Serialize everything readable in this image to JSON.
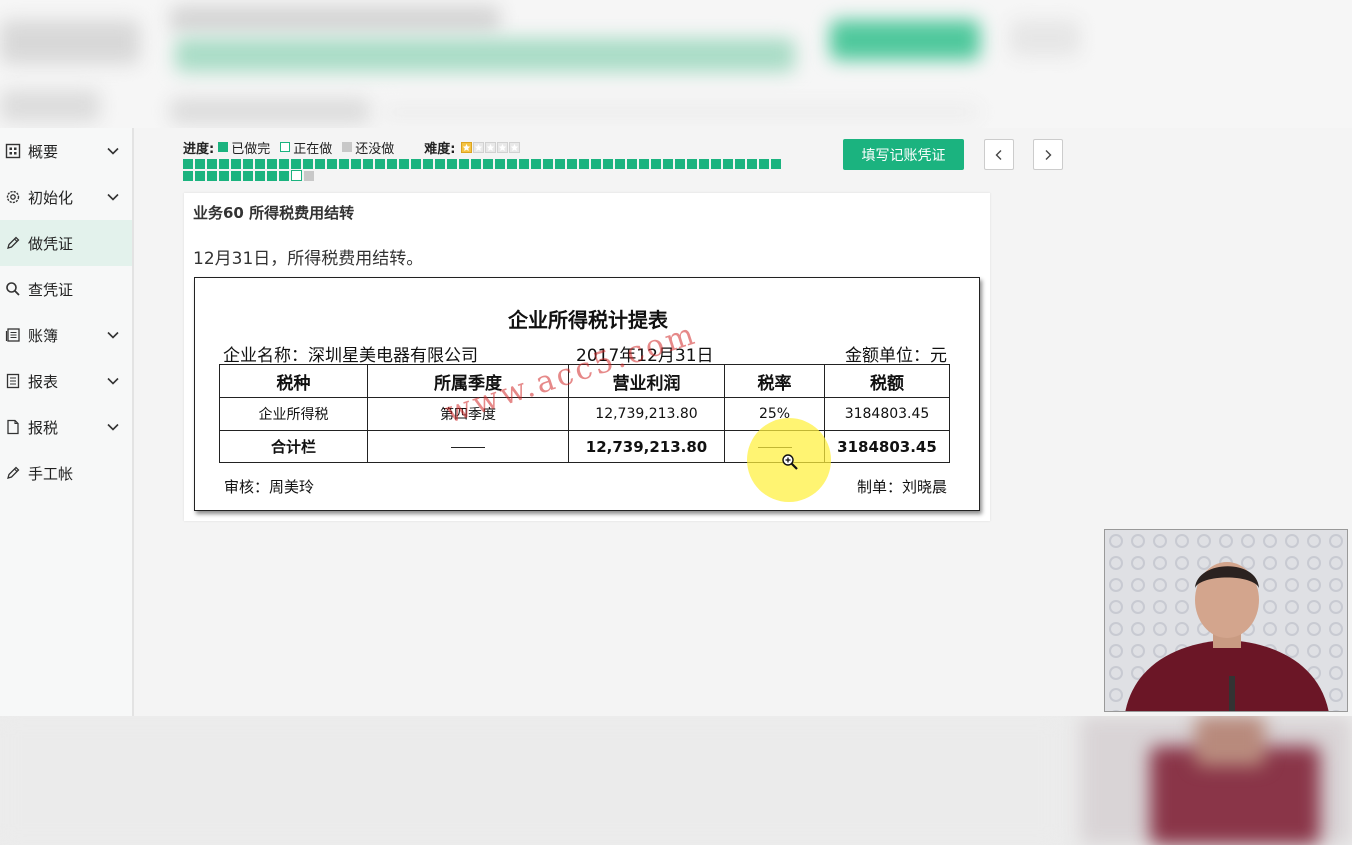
{
  "sidebar": {
    "items": [
      {
        "label": "概要",
        "icon": "dashboard-icon",
        "chevron": true
      },
      {
        "label": "初始化",
        "icon": "gear-icon",
        "chevron": true
      },
      {
        "label": "做凭证",
        "icon": "pen-icon",
        "chevron": false,
        "active": true
      },
      {
        "label": "查凭证",
        "icon": "search-icon",
        "chevron": false
      },
      {
        "label": "账簿",
        "icon": "ledger-icon",
        "chevron": true
      },
      {
        "label": "报表",
        "icon": "report-icon",
        "chevron": true
      },
      {
        "label": "报税",
        "icon": "document-icon",
        "chevron": true
      },
      {
        "label": "手工帐",
        "icon": "pen-icon",
        "chevron": false
      }
    ]
  },
  "legend": {
    "progress_label": "进度:",
    "done_label": "已做完",
    "doing_label": "正在做",
    "todo_label": "还没做",
    "difficulty_label": "难度:",
    "difficulty_stars": 1,
    "difficulty_max": 5
  },
  "progress": {
    "done_count": 59,
    "current": 60,
    "total": 61
  },
  "toolbar": {
    "fill_voucher_label": "填写记账凭证"
  },
  "task": {
    "title": "业务60 所得税费用结转",
    "description": "12月31日，所得税费用结转。"
  },
  "form": {
    "title": "企业所得税计提表",
    "company": "企业名称：深圳星美电器有限公司",
    "date": "2017年12月31日",
    "unit": "金额单位：元",
    "headers": [
      "税种",
      "所属季度",
      "营业利润",
      "税率",
      "税额"
    ],
    "rows": [
      [
        "企业所得税",
        "第四季度",
        "12,739,213.80",
        "25%",
        "3184803.45"
      ]
    ],
    "total_row": {
      "label": "合计栏",
      "profit": "12,739,213.80",
      "tax": "3184803.45"
    },
    "reviewer": "审核：周美玲",
    "preparer": "制单：刘晓晨",
    "watermark": "www.acc5.com"
  },
  "colors": {
    "accent": "#1bb37f",
    "active_nav_bg": "#e3f2ec"
  }
}
